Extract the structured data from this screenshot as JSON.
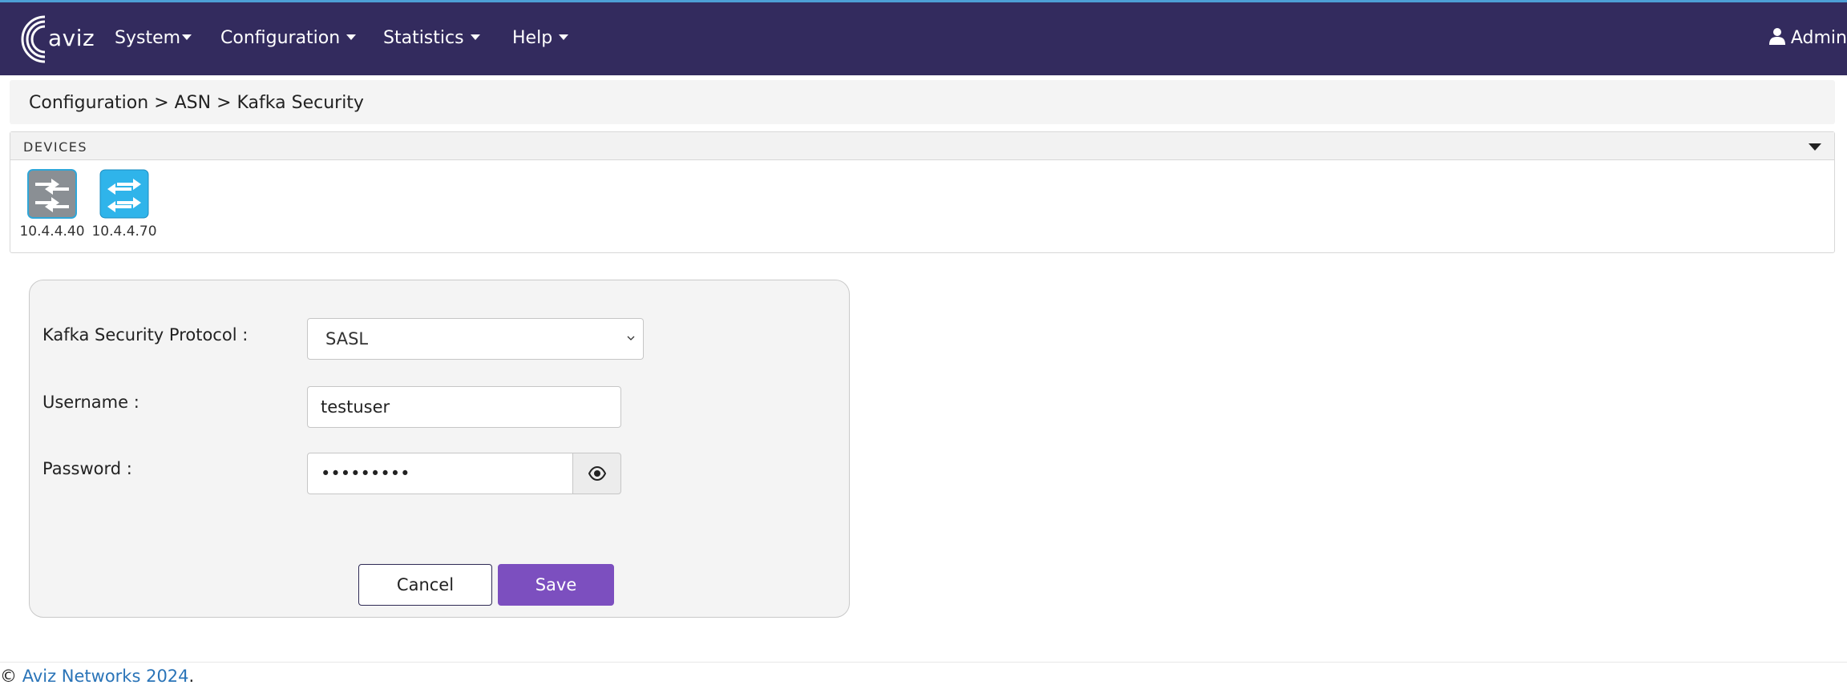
{
  "nav": {
    "logo_text": "aviz",
    "items": [
      {
        "label": "System"
      },
      {
        "label": "Configuration"
      },
      {
        "label": "Statistics"
      },
      {
        "label": "Help"
      }
    ],
    "user": "Admin"
  },
  "breadcrumb": "Configuration > ASN > Kafka Security",
  "devices": {
    "header": "DEVICES",
    "items": [
      {
        "ip": "10.4.4.40",
        "color": "#8a8f94",
        "selected": true
      },
      {
        "ip": "10.4.4.70",
        "color": "#2fb4ea",
        "selected": false
      }
    ]
  },
  "form": {
    "protocol_label": "Kafka Security Protocol :",
    "protocol_value": "SASL",
    "username_label": "Username :",
    "username_value": "testuser",
    "password_label": "Password :",
    "password_value": "•••••••••",
    "cancel_label": "Cancel",
    "save_label": "Save"
  },
  "footer": {
    "copyright": "©",
    "company": "Aviz Networks 2024",
    "period": "."
  },
  "colors": {
    "navbar": "#332b5e",
    "accent": "#7c4fbf",
    "link": "#2a74b8"
  }
}
